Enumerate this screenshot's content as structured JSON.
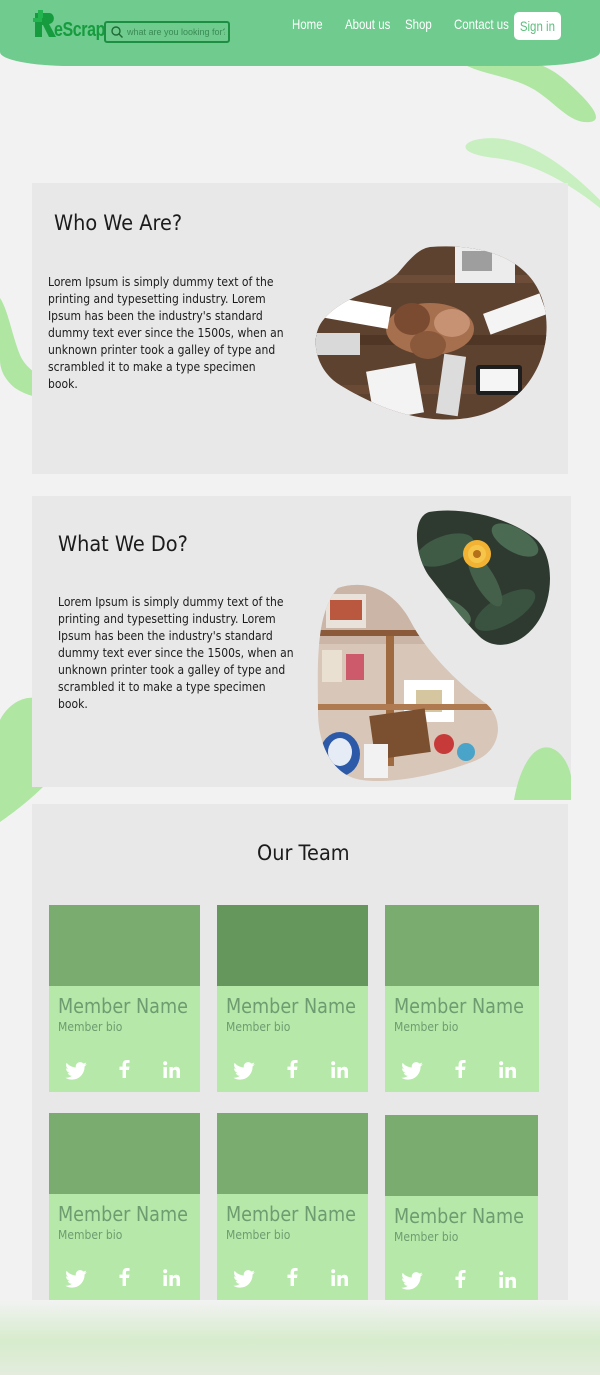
{
  "brand": {
    "name": "eScrap",
    "logo_accent": "#169c3f"
  },
  "search": {
    "placeholder": "what are you looking for?"
  },
  "nav": {
    "items": [
      "Home",
      "About us",
      "Shop",
      "Contact us"
    ],
    "signin_label": "Sign in"
  },
  "who": {
    "title": "Who We Are?",
    "text": "Lorem Ipsum is simply dummy text of the printing and typesetting industry. Lorem Ipsum has been the industry's standard dummy text ever since the 1500s, when an unknown printer took a galley of type and scrambled it to make a type specimen book."
  },
  "what": {
    "title": "What We Do?",
    "text": "Lorem Ipsum is simply dummy text of the printing and typesetting industry. Lorem Ipsum has been the industry's standard dummy text ever since the 1500s, when an unknown printer took a galley of type and scrambled it to make a type specimen book."
  },
  "team": {
    "title": "Our Team",
    "members": [
      {
        "name": "Member Name",
        "bio": "Member bio",
        "photo_color": "#7aac70"
      },
      {
        "name": "Member Name",
        "bio": "Member bio",
        "photo_color": "#65975c"
      },
      {
        "name": "Member Name",
        "bio": "Member bio",
        "photo_color": "#7aac70"
      },
      {
        "name": "Member Name",
        "bio": "Member bio",
        "photo_color": "#7aac70"
      },
      {
        "name": "Member Name",
        "bio": "Member bio",
        "photo_color": "#7aac70"
      },
      {
        "name": "Member Name",
        "bio": "Member bio",
        "photo_color": "#7aac70"
      }
    ],
    "social_icons": [
      "twitter-icon",
      "facebook-icon",
      "linkedin-icon"
    ]
  },
  "colors": {
    "header": "#6fcb8e",
    "card": "#b6e8a9",
    "card_text": "#6e9c70",
    "section": "#e8e8e8"
  }
}
